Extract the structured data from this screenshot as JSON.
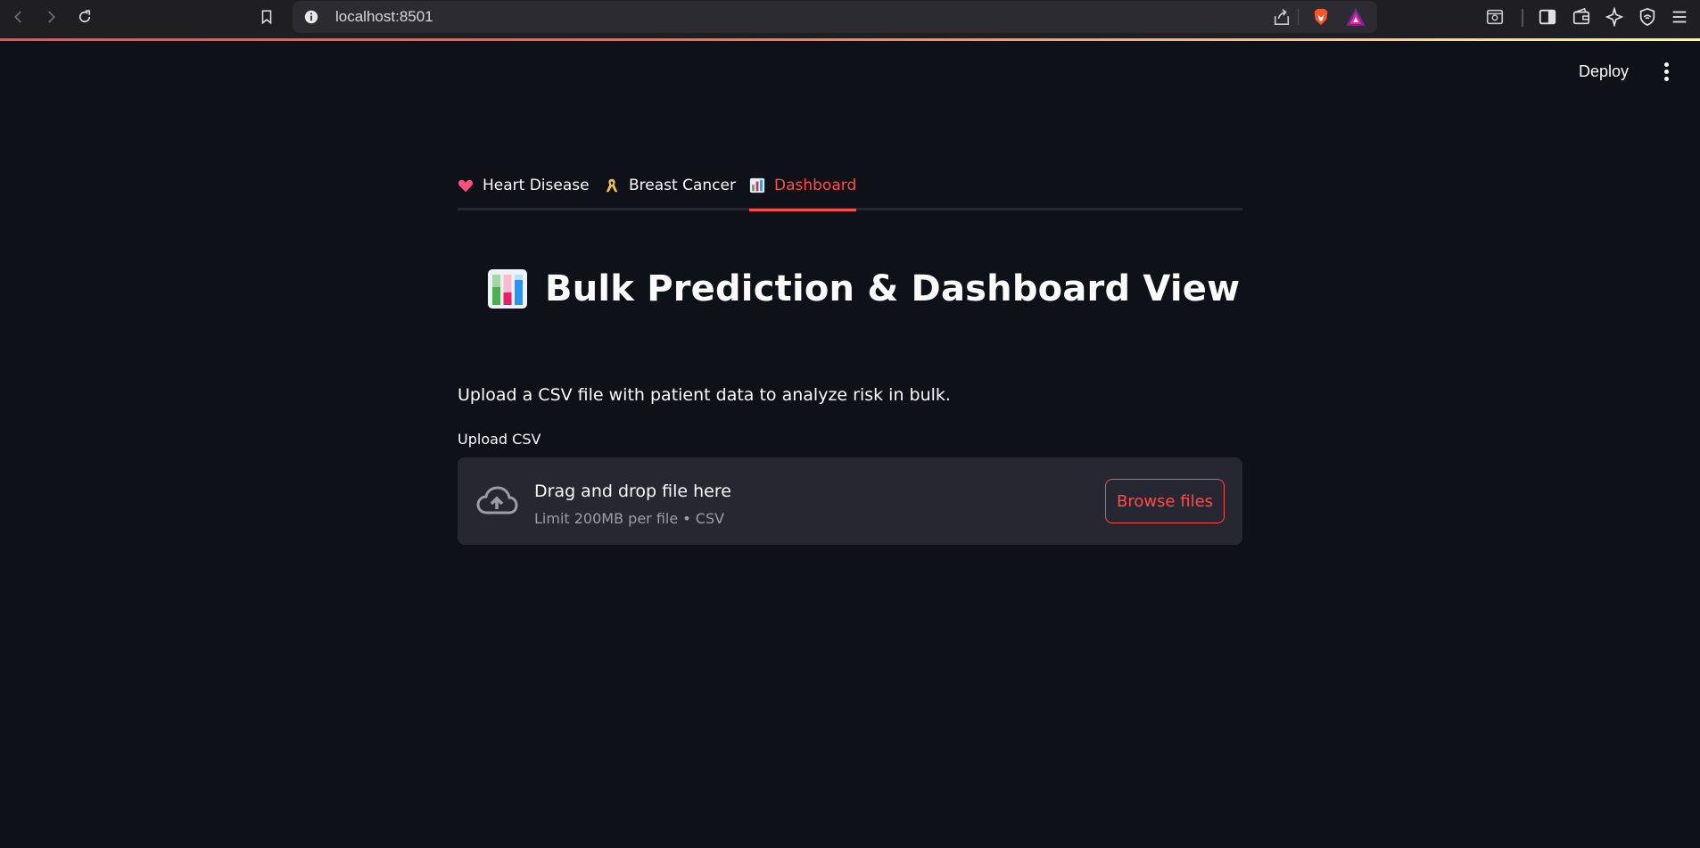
{
  "browser": {
    "url": "localhost:8501",
    "icons": [
      "back-icon",
      "forward-icon",
      "reload-icon",
      "bookmark-icon",
      "site-info-icon",
      "share-icon",
      "brave-shields-icon",
      "brave-rewards-icon",
      "reader-mode-icon",
      "sidebar-icon",
      "wallet-icon",
      "leo-ai-icon",
      "vpn-icon",
      "menu-icon"
    ]
  },
  "app_header": {
    "deploy_label": "Deploy"
  },
  "tabs": [
    {
      "label": "Heart Disease",
      "icon": "heart-emoji",
      "active": false
    },
    {
      "label": "Breast Cancer",
      "icon": "ribbon-emoji",
      "active": false
    },
    {
      "label": "Dashboard",
      "icon": "bar-chart-emoji",
      "active": true
    }
  ],
  "main": {
    "title": "Bulk Prediction & Dashboard View",
    "description": "Upload a CSV file with patient data to analyze risk in bulk.",
    "upload_label": "Upload CSV",
    "dropzone": {
      "title": "Drag and drop file here",
      "subtitle": "Limit 200MB per file • CSV",
      "browse_label": "Browse files"
    }
  },
  "colors": {
    "background": "#0e1117",
    "accent": "#ff4b4b",
    "dropzone_bg": "#262730",
    "muted_text": "#9d9da7"
  }
}
